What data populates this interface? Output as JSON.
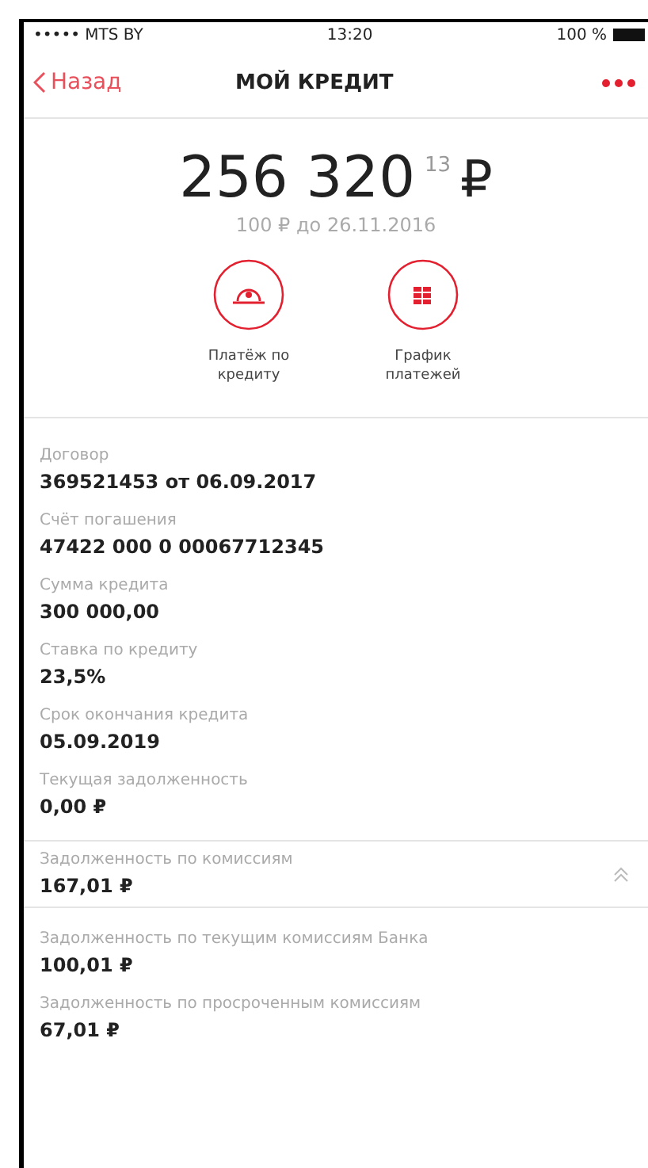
{
  "status_bar": {
    "carrier": "••••• MTS BY",
    "time": "13:20",
    "battery": "100 %"
  },
  "nav": {
    "back": "Назад",
    "title": "МОЙ КРЕДИТ"
  },
  "balance": {
    "integer": "256 320",
    "fraction": "13",
    "currency": "₽",
    "subtitle": "100 ₽ до 26.11.2016"
  },
  "actions": [
    {
      "kind": "payment",
      "label": "Платёж по кредиту"
    },
    {
      "kind": "schedule",
      "label": "График платежей"
    }
  ],
  "details": [
    {
      "label": "Договор",
      "value": "369521453 от 06.09.2017"
    },
    {
      "label": "Счёт погашения",
      "value": "47422 000 0 00067712345"
    },
    {
      "label": "Сумма кредита",
      "value": "300 000,00"
    },
    {
      "label": "Ставка по кредиту",
      "value": "23,5%"
    },
    {
      "label": "Срок окончания кредита",
      "value": "05.09.2019"
    },
    {
      "label": "Текущая задолженность",
      "value": "0,00 ₽"
    }
  ],
  "commissions": {
    "label": "Задолженность по комиссиям",
    "value": "167,01 ₽",
    "expanded": true,
    "children": [
      {
        "label": "Задолженность по текущим комиссиям Банка",
        "value": "100,01 ₽"
      },
      {
        "label": "Задолженность по просроченным комиссиям",
        "value": "67,01 ₽"
      }
    ]
  }
}
